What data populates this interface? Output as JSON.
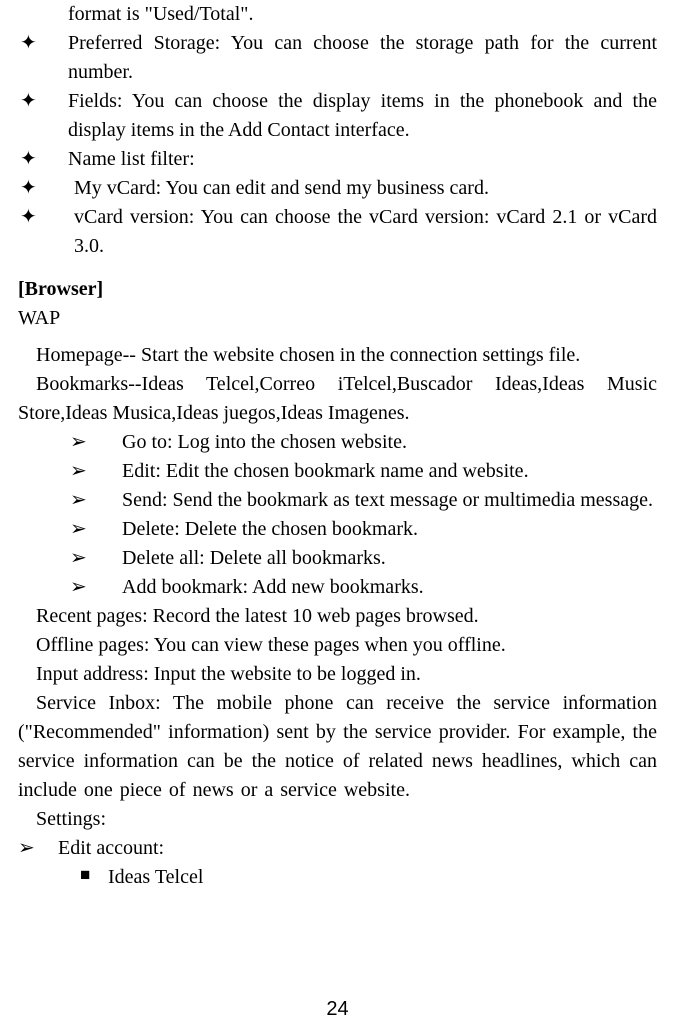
{
  "diamonds": [
    {
      "text": "format is \"Used/Total\".",
      "continuation": true
    },
    {
      "text": "Preferred Storage: You can choose the storage path for the current number.",
      "wide": true
    },
    {
      "text": "Fields: You can choose the display items in the phonebook and the display items in the Add Contact interface."
    },
    {
      "text": "Name list filter:"
    },
    {
      "text": "My vCard: You can edit and send my business card.",
      "pad": true
    },
    {
      "text": "vCard version: You can choose the vCard version: vCard 2.1 or vCard 3.0.",
      "pad": true
    }
  ],
  "browser": {
    "heading": "[Browser]",
    "wap": "WAP",
    "homepage": "Homepage-- Start the website chosen in the connection settings file.",
    "bookmarks": "Bookmarks--Ideas Telcel,Correo iTelcel,Buscador Ideas,Ideas Music Store,Ideas Musica,Ideas juegos,Ideas Imagenes.",
    "arrows": [
      "Go to: Log into the chosen website.",
      "Edit: Edit the chosen bookmark name and website.",
      "Send: Send the bookmark as text message or multimedia message.",
      "Delete: Delete the chosen bookmark.",
      "Delete all: Delete all bookmarks.",
      "Add bookmark: Add new bookmarks."
    ],
    "recent": "Recent pages: Record the latest 10 web pages browsed.",
    "offline": "Offline pages: You can view these pages when you offline.",
    "input": "Input address: Input the website to be logged in.",
    "service": "Service Inbox: The mobile phone can receive the service information (\"Recommended\" information) sent by the service provider. For example, the service information can be the notice of related news headlines, which can include one piece of news or a service website.",
    "settings": "Settings:",
    "edit_account": "Edit account:",
    "ideas_telcel": "Ideas Telcel"
  },
  "glyph": {
    "diamond": "✦",
    "arrow": "➢",
    "square": "■"
  },
  "page_number": "24"
}
